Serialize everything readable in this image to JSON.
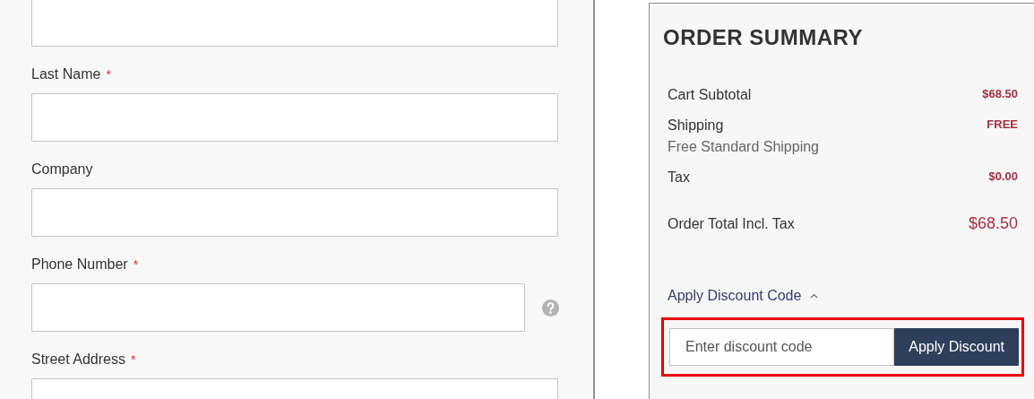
{
  "form": {
    "fields": [
      {
        "required": false,
        "help": false
      },
      {
        "label": "Last Name",
        "required": true,
        "help": false
      },
      {
        "label": "Company",
        "required": false,
        "help": false
      },
      {
        "label": "Phone Number",
        "required": true,
        "help": true
      },
      {
        "label": "Street Address",
        "required": true,
        "help": false
      }
    ],
    "required_mark": "*"
  },
  "summary": {
    "title": "ORDER SUMMARY",
    "rows": [
      {
        "kind": "line",
        "label": "Cart Subtotal",
        "value": "$68.50"
      },
      {
        "kind": "line",
        "label": "Shipping",
        "detail": "Free Standard Shipping",
        "value": "FREE"
      },
      {
        "kind": "line",
        "label": "Tax",
        "value": "$0.00"
      },
      {
        "kind": "total",
        "label": "Order Total Incl. Tax",
        "value": "$68.50"
      }
    ],
    "discount": {
      "toggle": "Apply Discount Code",
      "expanded": true,
      "placeholder": "Enter discount code",
      "button": "Apply Discount",
      "highlighted": true
    }
  }
}
